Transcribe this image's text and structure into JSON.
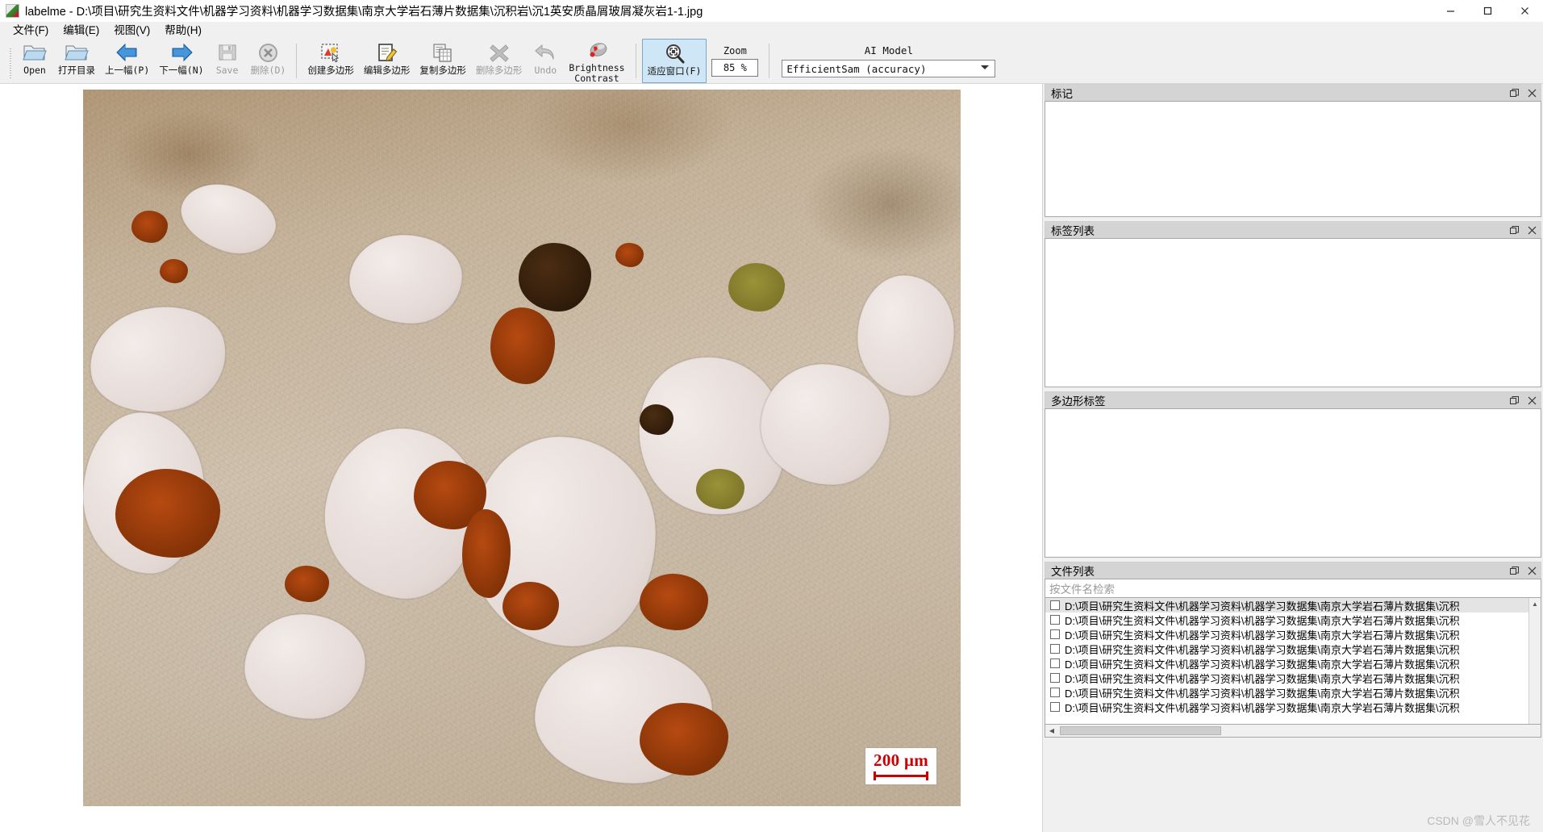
{
  "window": {
    "app_name": "labelme",
    "title": "labelme - D:\\项目\\研究生资料文件\\机器学习资料\\机器学习数据集\\南京大学岩石薄片数据集\\沉积岩\\沉1英安质晶屑玻屑凝灰岩1-1.jpg",
    "minimize": "–",
    "maximize": "☐",
    "close": "✕"
  },
  "menubar": {
    "items": [
      {
        "label": "文件(F)",
        "mnemonic": "F"
      },
      {
        "label": "编辑(E)",
        "mnemonic": "E"
      },
      {
        "label": "视图(V)",
        "mnemonic": "V"
      },
      {
        "label": "帮助(H)",
        "mnemonic": "H"
      }
    ]
  },
  "toolbar": {
    "buttons": [
      {
        "id": "open",
        "label": "Open",
        "icon": "open-folder-icon",
        "enabled": true,
        "active": false
      },
      {
        "id": "open-dir",
        "label": "打开目录",
        "icon": "open-folder-icon",
        "enabled": true,
        "active": false
      },
      {
        "id": "prev-image",
        "label": "上一幅(P)",
        "icon": "arrow-left-icon",
        "enabled": true,
        "active": false
      },
      {
        "id": "next-image",
        "label": "下一幅(N)",
        "icon": "arrow-right-icon",
        "enabled": true,
        "active": false
      },
      {
        "id": "save",
        "label": "Save",
        "icon": "floppy-disk-icon",
        "enabled": false,
        "active": false
      },
      {
        "id": "delete",
        "label": "删除(D)",
        "icon": "circle-x-icon",
        "enabled": false,
        "active": false
      },
      {
        "id": "create-polygon",
        "label": "创建多边形",
        "icon": "create-polygon-icon",
        "enabled": true,
        "active": false
      },
      {
        "id": "edit-polygon",
        "label": "编辑多边形",
        "icon": "edit-polygon-icon",
        "enabled": true,
        "active": false
      },
      {
        "id": "copy-polygon",
        "label": "复制多边形",
        "icon": "copy-polygon-icon",
        "enabled": true,
        "active": false
      },
      {
        "id": "delete-polygon",
        "label": "删除多边形",
        "icon": "x-mark-icon",
        "enabled": false,
        "active": false
      },
      {
        "id": "undo",
        "label": "Undo",
        "icon": "undo-arrow-icon",
        "enabled": false,
        "active": false
      },
      {
        "id": "brightness",
        "label": "Brightness",
        "label2": "Contrast",
        "icon": "brightness-icon",
        "enabled": true,
        "active": false
      },
      {
        "id": "fit-window",
        "label": "适应窗口(F)",
        "icon": "fit-window-icon",
        "enabled": true,
        "active": true
      }
    ],
    "zoom": {
      "label": "Zoom",
      "value": "85 %"
    },
    "ai_model": {
      "label": "AI Model",
      "value": "EfficientSam (accuracy)"
    }
  },
  "canvas": {
    "scalebar": {
      "text": "200 μm"
    }
  },
  "dock": {
    "panels": [
      {
        "id": "flags",
        "title": "标记",
        "float_icon": "restore-icon",
        "close_icon": "close-icon"
      },
      {
        "id": "label-list",
        "title": "标签列表",
        "float_icon": "restore-icon",
        "close_icon": "close-icon"
      },
      {
        "id": "polygon-labels",
        "title": "多边形标签",
        "float_icon": "restore-icon",
        "close_icon": "close-icon"
      },
      {
        "id": "file-list",
        "title": "文件列表",
        "float_icon": "restore-icon",
        "close_icon": "close-icon"
      }
    ],
    "file_search": {
      "placeholder": "按文件名检索",
      "value": ""
    },
    "files": [
      {
        "path": "D:\\项目\\研究生资料文件\\机器学习资料\\机器学习数据集\\南京大学岩石薄片数据集\\沉积",
        "checked": false,
        "selected": true
      },
      {
        "path": "D:\\项目\\研究生资料文件\\机器学习资料\\机器学习数据集\\南京大学岩石薄片数据集\\沉积",
        "checked": false,
        "selected": false
      },
      {
        "path": "D:\\项目\\研究生资料文件\\机器学习资料\\机器学习数据集\\南京大学岩石薄片数据集\\沉积",
        "checked": false,
        "selected": false
      },
      {
        "path": "D:\\项目\\研究生资料文件\\机器学习资料\\机器学习数据集\\南京大学岩石薄片数据集\\沉积",
        "checked": false,
        "selected": false
      },
      {
        "path": "D:\\项目\\研究生资料文件\\机器学习资料\\机器学习数据集\\南京大学岩石薄片数据集\\沉积",
        "checked": false,
        "selected": false
      },
      {
        "path": "D:\\项目\\研究生资料文件\\机器学习资料\\机器学习数据集\\南京大学岩石薄片数据集\\沉积",
        "checked": false,
        "selected": false
      },
      {
        "path": "D:\\项目\\研究生资料文件\\机器学习资料\\机器学习数据集\\南京大学岩石薄片数据集\\沉积",
        "checked": false,
        "selected": false
      },
      {
        "path": "D:\\项目\\研究生资料文件\\机器学习资料\\机器学习数据集\\南京大学岩石薄片数据集\\沉积",
        "checked": false,
        "selected": false
      }
    ],
    "scroll_up": "▲",
    "scroll_down": "▼",
    "scroll_left": "◀",
    "scroll_right": "▶"
  },
  "watermark": "CSDN @雪人不见花",
  "colors": {
    "accent": "#cfe6f7",
    "accent_border": "#7aa7c7",
    "panel_title_bg": "#d4d4d4",
    "scalebar_red": "#cc0000",
    "disabled_text": "#9a9a9a"
  }
}
